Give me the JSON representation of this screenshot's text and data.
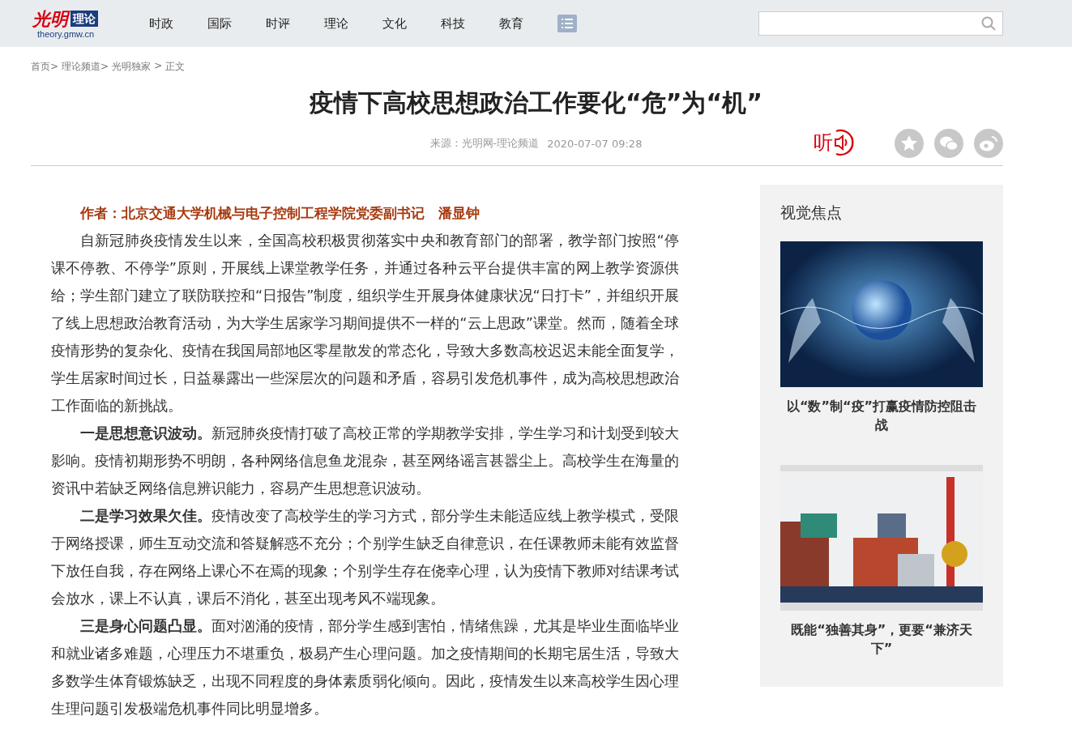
{
  "logo": {
    "mark": "光明",
    "badge": "理论",
    "domain": "theory.gmw.cn"
  },
  "nav": [
    {
      "label": "时政"
    },
    {
      "label": "国际"
    },
    {
      "label": "时评"
    },
    {
      "label": "理论"
    },
    {
      "label": "文化"
    },
    {
      "label": "科技"
    },
    {
      "label": "教育"
    }
  ],
  "breadcrumb": [
    "首页>",
    "理论频道>",
    "光明独家",
    ">",
    "正文"
  ],
  "article": {
    "title": "疫情下高校思想政治工作要化“危”为“机”",
    "source": "来源：光明网-理论频道",
    "date": "2020-07-07 09:28",
    "listen": "听",
    "author": "作者：北京交通大学机械与电子控制工程学院党委副书记　潘显钟",
    "paragraphs": [
      "自新冠肺炎疫情发生以来，全国高校积极贯彻落实中央和教育部门的部署，教学部门按照“停课不停教、不停学”原则，开展线上课堂教学任务，并通过各种云平台提供丰富的网上教学资源供给；学生部门建立了联防联控和“日报告”制度，组织学生开展身体健康状况“日打卡”，并组织开展了线上思想政治教育活动，为大学生居家学习期间提供不一样的“云上思政”课堂。然而，随着全球疫情形势的复杂化、疫情在我国局部地区零星散发的常态化，导致大多数高校迟迟未能全面复学，学生居家时间过长，日益暴露出一些深层次的问题和矛盾，容易引发危机事件，成为高校思想政治工作面临的新挑战。",
      "**一是思想意识波动。**新冠肺炎疫情打破了高校正常的学期教学安排，学生学习和计划受到较大影响。疫情初期形势不明朗，各种网络信息鱼龙混杂，甚至网络谣言甚嚣尘上。高校学生在海量的资讯中若缺乏网络信息辨识能力，容易产生思想意识波动。",
      "**二是学习效果欠佳。**疫情改变了高校学生的学习方式，部分学生未能适应线上教学模式，受限于网络授课，师生互动交流和答疑解惑不充分；个别学生缺乏自律意识，在任课教师未能有效监督下放任自我，存在网络上课心不在焉的现象；个别学生存在侥幸心理，认为疫情下教师对结课考试会放水，课上不认真，课后不消化，甚至出现考风不端现象。",
      "**三是身心问题凸显。**面对汹涌的疫情，部分学生感到害怕，情绪焦躁，尤其是毕业生面临毕业和就业诸多难题，心理压力不堪重负，极易产生心理问题。加之疫情期间的长期宅居生活，导致大多数学生体育锻炼缺乏，出现不同程度的身体素质弱化倾向。因此，疫情发生以来高校学生因心理生理问题引发极端危机事件同比明显增多。"
    ]
  },
  "sidebar": {
    "title": "视觉焦点",
    "items": [
      {
        "kind": "globe",
        "caption": "以“数”制“疫”打赢疫情防控阻击战"
      },
      {
        "kind": "port",
        "caption": "既能“独善其身”，更要“兼济天下”"
      }
    ]
  }
}
